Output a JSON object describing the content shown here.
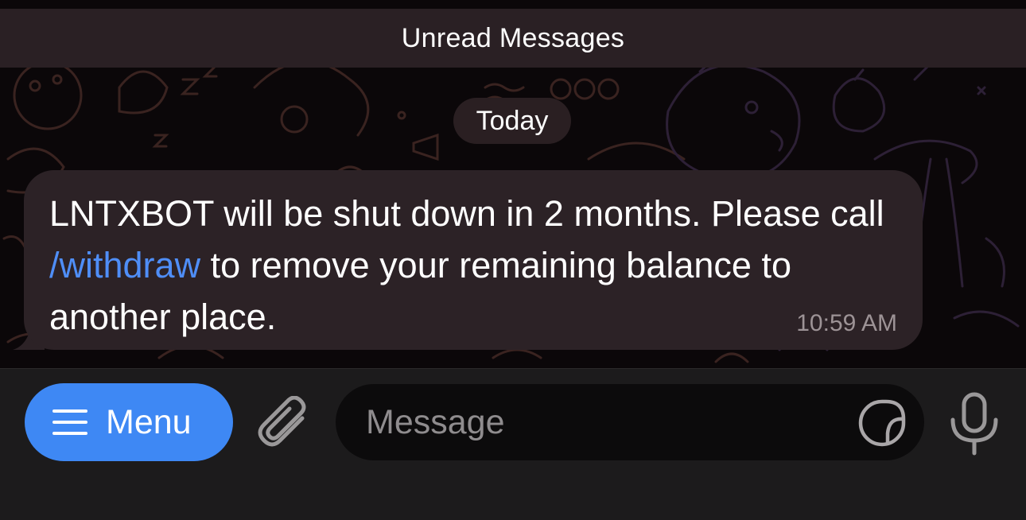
{
  "banner": {
    "unread_label": "Unread Messages"
  },
  "date_separator": {
    "label": "Today"
  },
  "message": {
    "text_before_link": "LNTXBOT will be shut down in 2 months. Please call ",
    "link_text": "/withdraw",
    "text_after_link": " to remove your remaining balance to another place.",
    "time": "10:59 AM"
  },
  "input_bar": {
    "menu_label": "Menu",
    "message_placeholder": "Message",
    "icons": {
      "menu": "hamburger-icon",
      "attach": "paperclip-icon",
      "sticker": "sticker-icon",
      "voice": "microphone-icon"
    }
  },
  "colors": {
    "accent": "#3e88f4",
    "link": "#4f8ef7",
    "bubble": "#2c2226",
    "banner": "#2a2024",
    "bottom_bar": "#1c1b1c",
    "field": "#0c0b0c"
  }
}
